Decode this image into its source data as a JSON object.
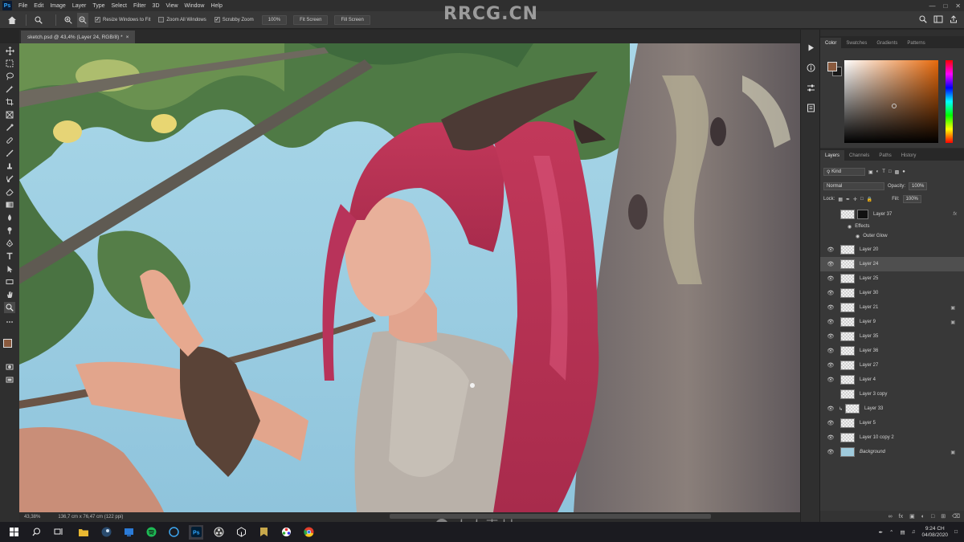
{
  "menu": [
    "File",
    "Edit",
    "Image",
    "Layer",
    "Type",
    "Select",
    "Filter",
    "3D",
    "View",
    "Window",
    "Help"
  ],
  "app_logo": "Ps",
  "watermark_top": "RRCG.CN",
  "options": {
    "resize_windows": "Resize Windows to Fit",
    "zoom_all": "Zoom All Windows",
    "scrubby_zoom": "Scrubby Zoom",
    "zoom_100": "100%",
    "fit_screen": "Fit Screen",
    "fill_screen": "Fill Screen"
  },
  "document_tab": {
    "title": "sketch.psd @ 43,4% (Layer 24, RGB/8) *",
    "close": "×"
  },
  "status": {
    "zoom": "43,38%",
    "size": "136,7 cm x 76,47 cm (122 ppi)"
  },
  "color_tabs": [
    "Color",
    "Swatches",
    "Gradients",
    "Patterns"
  ],
  "colors": {
    "foreground": "#8a5a3e",
    "background": "#1a1a1a",
    "hue": "#e86a0c"
  },
  "layers_tabs": [
    "Layers",
    "Channels",
    "Paths",
    "History"
  ],
  "layers_controls": {
    "filter_kind": "Kind",
    "blend_mode": "Normal",
    "opacity_label": "Opacity:",
    "opacity_value": "100%",
    "lock_label": "Lock:",
    "fill_label": "Fill:",
    "fill_value": "100%"
  },
  "layer_group": {
    "name": "Layer 37",
    "fx": "fx",
    "effects": "Effects",
    "effect_item": "Outer Glow"
  },
  "layers": [
    {
      "name": "Layer 20",
      "visible": true,
      "selected": false,
      "locked": false
    },
    {
      "name": "Layer 24",
      "visible": true,
      "selected": true,
      "locked": false
    },
    {
      "name": "Layer 25",
      "visible": true,
      "selected": false,
      "locked": false
    },
    {
      "name": "Layer 30",
      "visible": true,
      "selected": false,
      "locked": false
    },
    {
      "name": "Layer 21",
      "visible": true,
      "selected": false,
      "locked": true
    },
    {
      "name": "Layer 9",
      "visible": true,
      "selected": false,
      "locked": true
    },
    {
      "name": "Layer 35",
      "visible": true,
      "selected": false,
      "locked": false
    },
    {
      "name": "Layer 36",
      "visible": true,
      "selected": false,
      "locked": false
    },
    {
      "name": "Layer 27",
      "visible": true,
      "selected": false,
      "locked": false
    },
    {
      "name": "Layer 4",
      "visible": true,
      "selected": false,
      "locked": false
    },
    {
      "name": "Layer 3 copy",
      "visible": false,
      "selected": false,
      "locked": false
    },
    {
      "name": "Layer 33",
      "visible": true,
      "selected": false,
      "locked": false
    },
    {
      "name": "Layer 5",
      "visible": true,
      "selected": false,
      "locked": false
    },
    {
      "name": "Layer 10 copy 2",
      "visible": true,
      "selected": false,
      "locked": false
    },
    {
      "name": "Background",
      "visible": true,
      "selected": false,
      "locked": true
    }
  ],
  "watermark_bottom": "人人素材",
  "clock": {
    "time": "9:24 CH",
    "date": "04/08/2020"
  }
}
